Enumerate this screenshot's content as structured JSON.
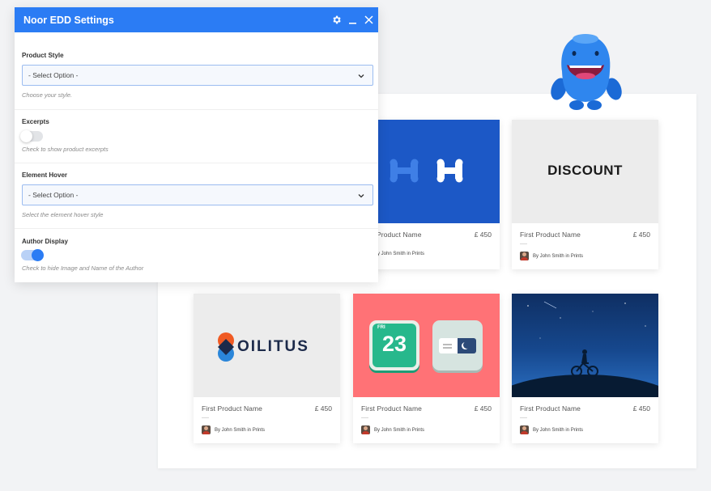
{
  "settings_panel": {
    "title": "Noor EDD Settings",
    "icons": {
      "settings": "gear-icon",
      "minimize": "minimize-icon",
      "close": "close-icon"
    },
    "accent_color": "#2b7cf4",
    "fields": {
      "product_style": {
        "label": "Product Style",
        "selected": "- Select Option -",
        "help": "Choose your style."
      },
      "excerpts": {
        "label": "Excerpts",
        "enabled": false,
        "help": "Check to show product excerpts"
      },
      "element_hover": {
        "label": "Element Hover",
        "selected": "- Select Option -",
        "help": "Select the element hover style"
      },
      "author_display": {
        "label": "Author Display",
        "enabled": true,
        "help": "Check to hide Image and Name of the Author"
      }
    }
  },
  "products": [
    {
      "name": "First Product Name",
      "price": "£ 450",
      "author": "By John Smith in Prints",
      "thumb": "blue-hh-logo"
    },
    {
      "name": "First Product Name",
      "price": "£ 450",
      "author": "By John Smith in Prints",
      "thumb": "discount-logo"
    },
    {
      "name": "First Product Name",
      "price": "£ 450",
      "author": "By John Smith in Prints",
      "thumb": "oilitus-logo"
    },
    {
      "name": "First Product Name",
      "price": "£ 450",
      "author": "By John Smith in Prints",
      "thumb": "calendar-app-icons"
    },
    {
      "name": "First Product Name",
      "price": "£ 450",
      "author": "By John Smith in Prints",
      "thumb": "night-cyclist"
    }
  ],
  "partial_card": {
    "name": "Product Name",
    "price": "£ 450",
    "author": "By John Smith in Prints"
  },
  "logos": {
    "discount": "DISCOUNT",
    "oilitus": "OILITUS",
    "calendar_day": "FRI",
    "calendar_date": "23"
  }
}
